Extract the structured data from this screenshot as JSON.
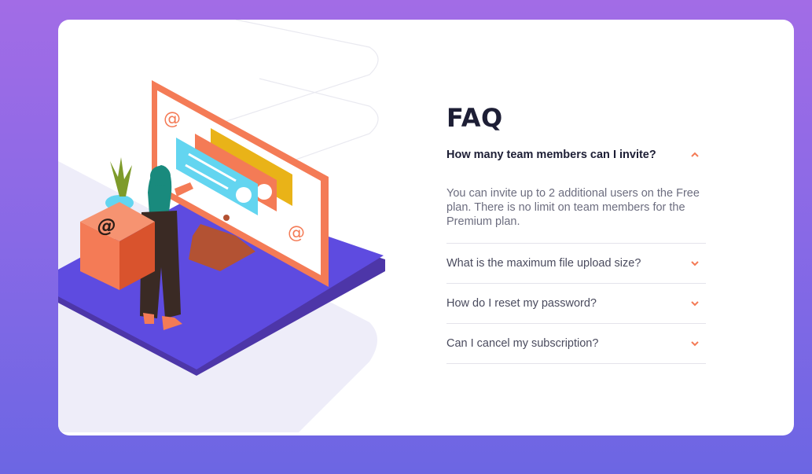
{
  "faq": {
    "title": "FAQ",
    "items": [
      {
        "question": "How many team members can I invite?",
        "expanded": true,
        "answer": "You can invite up to 2 additional users on the Free plan. There is no limit on team members for the Premium plan."
      },
      {
        "question": "What is the maximum file upload size?",
        "expanded": false
      },
      {
        "question": "How do I reset my password?",
        "expanded": false
      },
      {
        "question": "Can I cancel my subscription?",
        "expanded": false
      }
    ]
  },
  "colors": {
    "background_top": "#a26ce6",
    "background_bottom": "#6c66e3",
    "card": "#ffffff",
    "title": "#1d1e35",
    "accent": "#f47b56",
    "divider": "#e4e3eb"
  },
  "icons": {
    "chevron_up": "chevron-up-icon",
    "chevron_down": "chevron-down-icon",
    "cube": "at-sign-box-icon"
  }
}
